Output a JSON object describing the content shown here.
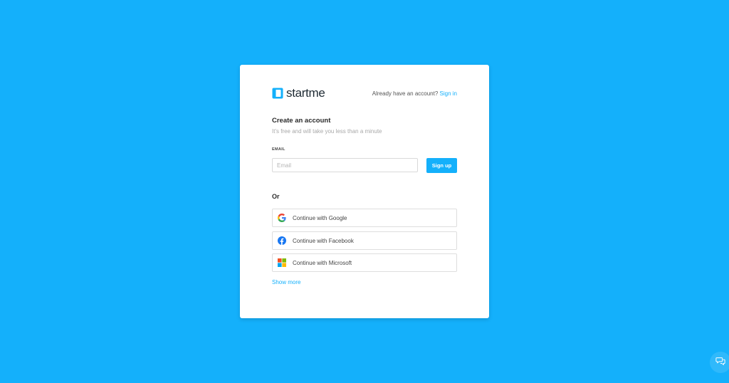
{
  "brand": {
    "name": "startme",
    "accent_color": "#14b0fb"
  },
  "header": {
    "already_text": "Already have an account?",
    "signin_label": "Sign in"
  },
  "form": {
    "title": "Create an account",
    "subtitle": "It's free and will take you less than a minute",
    "email_label": "EMAIL",
    "email_placeholder": "Email",
    "email_value": "",
    "signup_label": "Sign up"
  },
  "or_label": "Or",
  "oauth": [
    {
      "label": "Continue with Google",
      "icon": "google-icon"
    },
    {
      "label": "Continue with Facebook",
      "icon": "facebook-icon"
    },
    {
      "label": "Continue with Microsoft",
      "icon": "microsoft-icon"
    }
  ],
  "show_more_label": "Show more",
  "chat": {
    "icon": "chat-icon"
  }
}
